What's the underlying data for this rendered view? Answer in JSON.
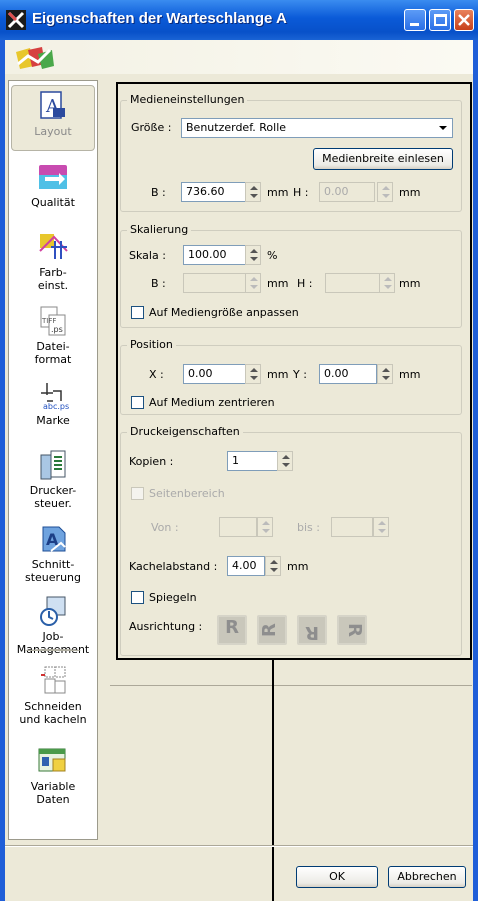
{
  "window": {
    "title": "Eigenschaften der Warteschlange A"
  },
  "sidebar": {
    "items": [
      {
        "label": "Layout",
        "icon": "layout-icon"
      },
      {
        "label": "Qualität",
        "icon": "quality-icon"
      },
      {
        "label": "Farb-\neinst.",
        "icon": "color-settings-icon"
      },
      {
        "label": "Datei-\nformat",
        "icon": "file-format-icon"
      },
      {
        "label": "Marke",
        "icon": "mark-icon"
      },
      {
        "label": "Drucker-\nsteuer.",
        "icon": "printer-control-icon"
      },
      {
        "label": "Schnitt-\nsteuerung",
        "icon": "cut-control-icon"
      },
      {
        "label": "Job-\nManagement",
        "icon": "job-management-icon"
      },
      {
        "label": "Schneiden\nund kacheln",
        "icon": "cut-and-tile-icon"
      },
      {
        "label": "Variable\nDaten",
        "icon": "variable-data-icon"
      }
    ]
  },
  "media": {
    "group_title": "Medieneinstellungen",
    "size_label": "Größe :",
    "size_value": "Benutzerdef. Rolle",
    "read_width_button": "Medienbreite einlesen",
    "width_label": "B :",
    "width_value": "736.60",
    "width_unit": "mm",
    "height_label": "H :",
    "height_value": "0.00",
    "height_unit": "mm"
  },
  "scaling": {
    "group_title": "Skalierung",
    "scale_label": "Skala :",
    "scale_value": "100.00",
    "scale_unit": "%",
    "width_label": "B :",
    "width_unit": "mm",
    "height_label": "H :",
    "height_unit": "mm",
    "fit_label": "Auf Mediengröße anpassen"
  },
  "position": {
    "group_title": "Position",
    "x_label": "X :",
    "x_value": "0.00",
    "x_unit": "mm",
    "y_label": "Y :",
    "y_value": "0.00",
    "y_unit": "mm",
    "center_label": "Auf Medium zentrieren"
  },
  "print": {
    "group_title": "Druckeigenschaften",
    "copies_label": "Kopien :",
    "copies_value": "1",
    "page_range_label": "Seitenbereich",
    "from_label": "Von :",
    "to_label": "bis :",
    "tile_gap_label": "Kachelabstand :",
    "tile_gap_value": "4.00",
    "tile_gap_unit": "mm",
    "mirror_label": "Spiegeln",
    "orientation_label": "Ausrichtung :",
    "orientation_glyphs": [
      "R",
      "R",
      "R",
      "R"
    ]
  },
  "footer": {
    "ok": "OK",
    "cancel": "Abbrechen"
  },
  "colors": {
    "titlebar": "#0a5ad8",
    "dialog_bg": "#ece9d8",
    "close_button": "#c7401b"
  }
}
